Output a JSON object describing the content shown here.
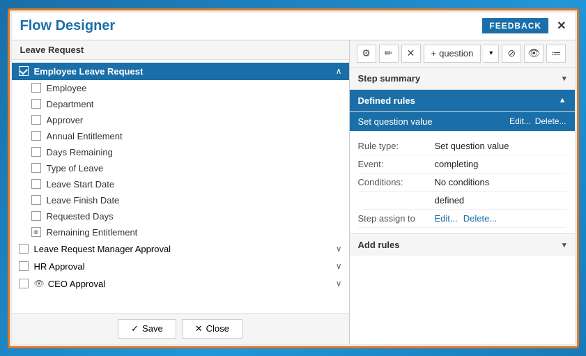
{
  "title": "Flow Designer",
  "feedback_label": "FEEDBACK",
  "close_icon": "✕",
  "left_panel": {
    "header": "Leave Request",
    "groups": [
      {
        "id": "employee-leave-request",
        "label": "Employee Leave Request",
        "active": true,
        "has_chevron": true,
        "children": [
          {
            "id": "employee",
            "label": "Employee",
            "has_icon": false
          },
          {
            "id": "department",
            "label": "Department",
            "has_icon": false
          },
          {
            "id": "approver",
            "label": "Approver",
            "has_icon": false
          },
          {
            "id": "annual-entitlement",
            "label": "Annual Entitlement",
            "has_icon": false
          },
          {
            "id": "days-remaining",
            "label": "Days Remaining",
            "has_icon": false
          },
          {
            "id": "type-of-leave",
            "label": "Type of Leave",
            "has_icon": false
          },
          {
            "id": "leave-start-date",
            "label": "Leave Start Date",
            "has_icon": false
          },
          {
            "id": "leave-finish-date",
            "label": "Leave Finish Date",
            "has_icon": false
          },
          {
            "id": "requested-days",
            "label": "Requested Days",
            "has_icon": false
          },
          {
            "id": "remaining-entitlement",
            "label": "Remaining Entitlement",
            "has_icon": true
          }
        ]
      },
      {
        "id": "leave-request-manager-approval",
        "label": "Leave Request Manager Approval",
        "active": false,
        "has_chevron": true,
        "children": []
      },
      {
        "id": "hr-approval",
        "label": "HR Approval",
        "active": false,
        "has_chevron": true,
        "children": []
      },
      {
        "id": "ceo-approval",
        "label": "CEO Approval",
        "active": false,
        "has_chevron": true,
        "has_special_icon": true,
        "children": []
      }
    ],
    "footer": {
      "save_label": "Save",
      "close_label": "Close",
      "save_icon": "✓",
      "close_icon": "✕"
    }
  },
  "right_panel": {
    "toolbar": {
      "gear_icon": "⚙",
      "pencil_icon": "✎",
      "times_icon": "✕",
      "plus_icon": "+",
      "question_label": "question",
      "dropdown_icon": "▾",
      "ban_icon": "⊘",
      "eye_icon": "👁",
      "sliders_icon": "⇌"
    },
    "step_summary": {
      "label": "Step summary",
      "chevron": "▾"
    },
    "defined_rules": {
      "label": "Defined rules",
      "chevron": "▲",
      "rules": [
        {
          "id": "set-question-value",
          "label": "Set question value",
          "selected": true,
          "edit_label": "Edit...",
          "delete_label": "Delete..."
        }
      ],
      "details": [
        {
          "label": "Rule type:",
          "value": "Set question value"
        },
        {
          "label": "Event:",
          "value": "completing"
        },
        {
          "label": "Conditions:",
          "value": "No conditions"
        },
        {
          "label": "",
          "value": "defined"
        }
      ],
      "step_assign_to": {
        "label": "Step assign to",
        "edit_label": "Edit...",
        "delete_label": "Delete..."
      }
    },
    "add_rules": {
      "label": "Add rules",
      "chevron": "▾"
    }
  }
}
